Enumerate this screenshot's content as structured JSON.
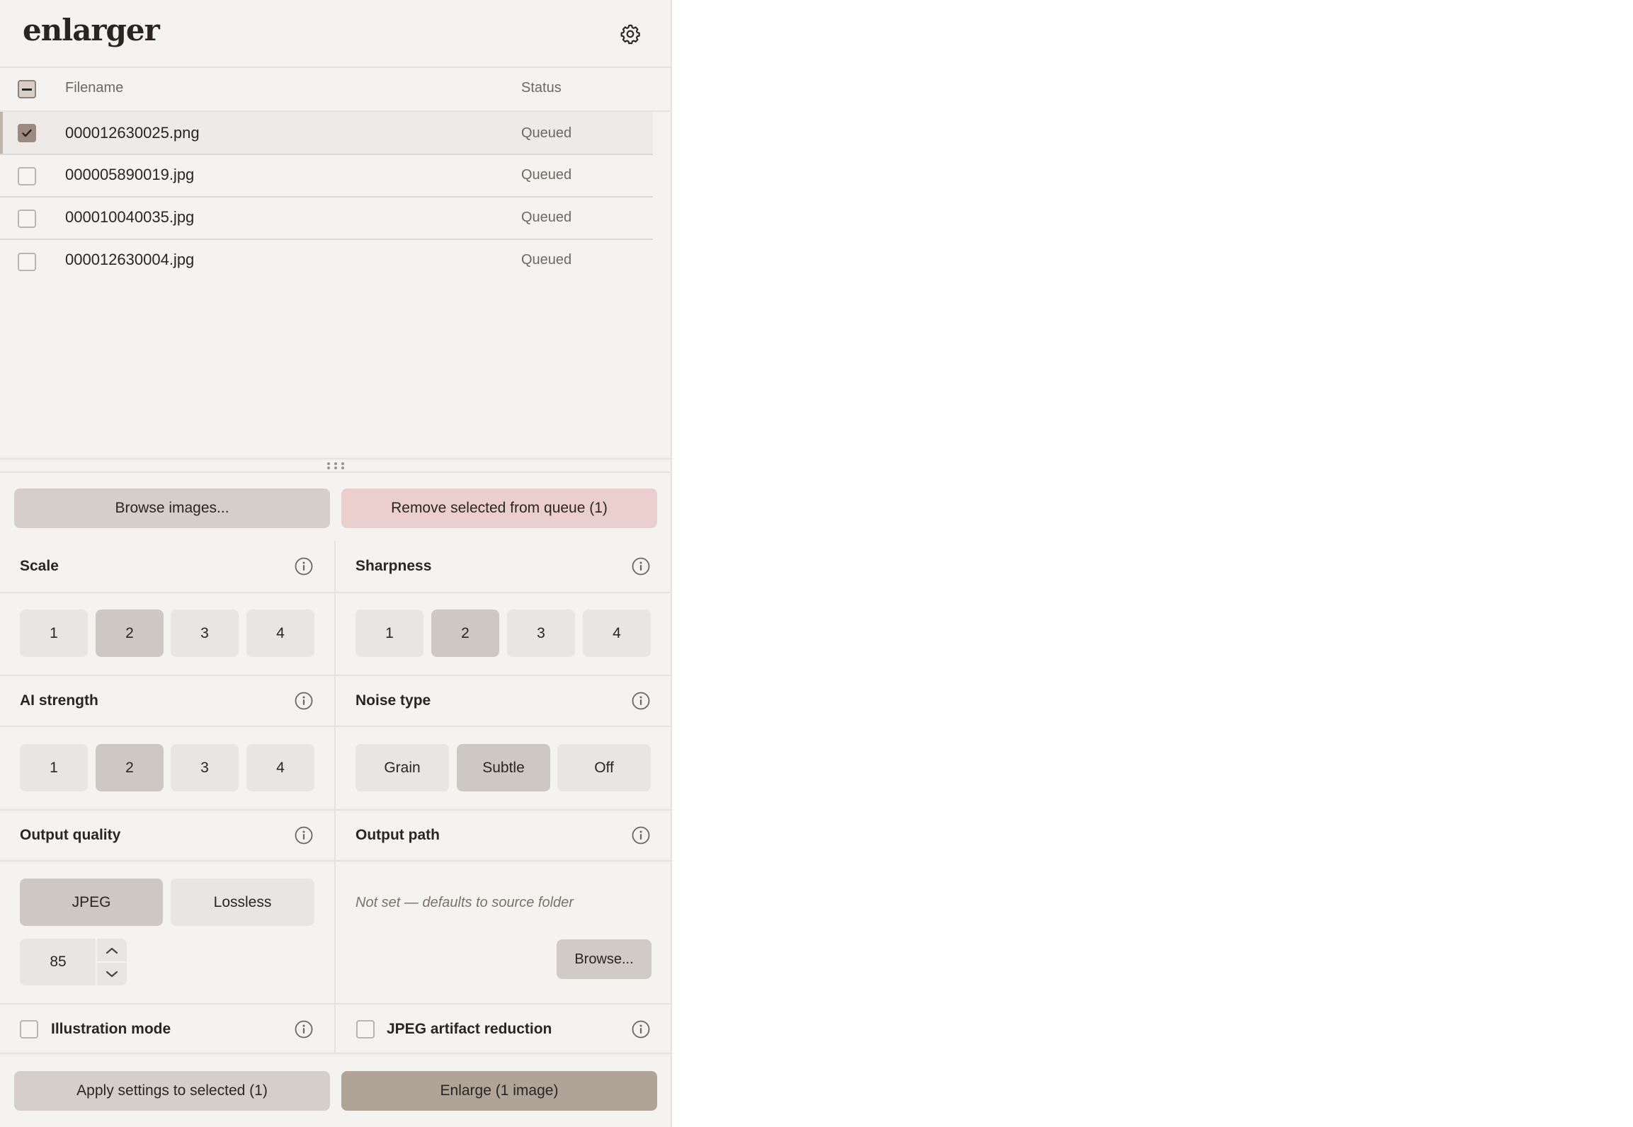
{
  "app": {
    "title": "enlarger"
  },
  "table": {
    "columns": {
      "filename": "Filename",
      "status": "Status"
    },
    "rows": [
      {
        "filename": "000012630025.png",
        "status": "Queued",
        "selected": true
      },
      {
        "filename": "000005890019.jpg",
        "status": "Queued",
        "selected": false
      },
      {
        "filename": "000010040035.jpg",
        "status": "Queued",
        "selected": false
      },
      {
        "filename": "000012630004.jpg",
        "status": "Queued",
        "selected": false
      }
    ]
  },
  "actions": {
    "browse_images": "Browse images...",
    "remove_selected": "Remove selected from queue (1)",
    "apply_settings": "Apply settings to selected (1)",
    "enlarge": "Enlarge (1 image)"
  },
  "settings": {
    "scale": {
      "label": "Scale",
      "options": [
        "1",
        "2",
        "3",
        "4"
      ],
      "selected": "2"
    },
    "sharpness": {
      "label": "Sharpness",
      "options": [
        "1",
        "2",
        "3",
        "4"
      ],
      "selected": "2"
    },
    "ai_strength": {
      "label": "AI strength",
      "options": [
        "1",
        "2",
        "3",
        "4"
      ],
      "selected": "2"
    },
    "noise_type": {
      "label": "Noise type",
      "options": [
        "Grain",
        "Subtle",
        "Off"
      ],
      "selected": "Subtle"
    },
    "output_quality": {
      "label": "Output quality",
      "options": [
        "JPEG",
        "Lossless"
      ],
      "selected": "JPEG",
      "jpeg_quality": "85"
    },
    "output_path": {
      "label": "Output path",
      "placeholder": "Not set — defaults to source folder",
      "browse": "Browse..."
    },
    "illustration_mode": {
      "label": "Illustration mode",
      "checked": false
    },
    "jpeg_artifact_reduction": {
      "label": "JPEG artifact reduction",
      "checked": false
    }
  },
  "colors": {
    "panel_bg": "#f5f3f0",
    "accent": "#b0a398",
    "danger_soft": "#ebcfcf",
    "neutral_button": "#d6ceca"
  }
}
